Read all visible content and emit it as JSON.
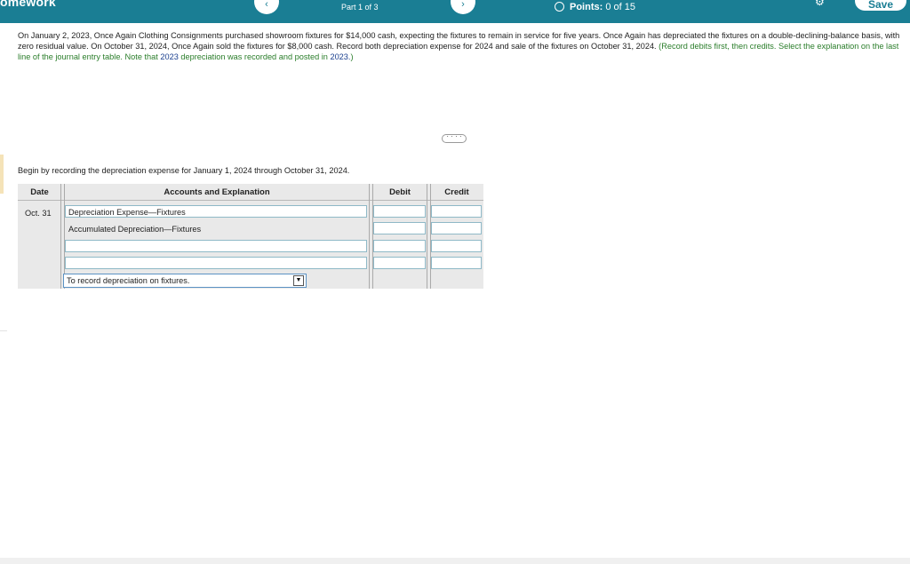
{
  "header": {
    "brand": "omework",
    "prev_label": "‹",
    "next_label": "›",
    "part": "Part 1 of 3",
    "points_label": "Points:",
    "points_value": "0 of 15",
    "gear_icon": "⚙",
    "save_label": "Save"
  },
  "problem": {
    "text": "On January 2, 2023, Once Again Clothing Consignments purchased showroom fixtures for $14,000 cash, expecting the fixtures to remain in service for five years. Once Again has depreciated the fixtures on a double-declining-balance basis, with zero residual value. On October 31, 2024, Once Again sold the fixtures for $8,000 cash. Record both depreciation expense for 2024 and sale of the fixtures on October 31, 2024.",
    "green_a": "(Record debits first, then credits. Select the explanation on the last line of the journal entry table. Note that",
    "blue_year_a": "2023",
    "green_b": "depreciation was recorded and posted in",
    "blue_year_b": "2023.",
    "green_c": ")",
    "more_label": "· · · ·"
  },
  "instruction": "Begin by recording the depreciation expense for January 1, 2024 through October 31, 2024.",
  "journal": {
    "headers": {
      "date": "Date",
      "accounts": "Accounts and Explanation",
      "debit": "Debit",
      "credit": "Credit"
    },
    "date": "Oct. 31",
    "rows": [
      {
        "account": "Depreciation Expense—Fixtures",
        "debit": "",
        "credit": ""
      },
      {
        "account": "Accumulated Depreciation—Fixtures",
        "debit": "",
        "credit": ""
      },
      {
        "account": "",
        "debit": "",
        "credit": ""
      },
      {
        "account": "",
        "debit": "",
        "credit": ""
      }
    ],
    "explanation": "To record depreciation on fixtures.",
    "dropdown_arrow": "▼"
  },
  "colors": {
    "topbar": "#1a7e94",
    "table_bg": "#e9e9e9",
    "field_border": "#8fb9c7"
  }
}
